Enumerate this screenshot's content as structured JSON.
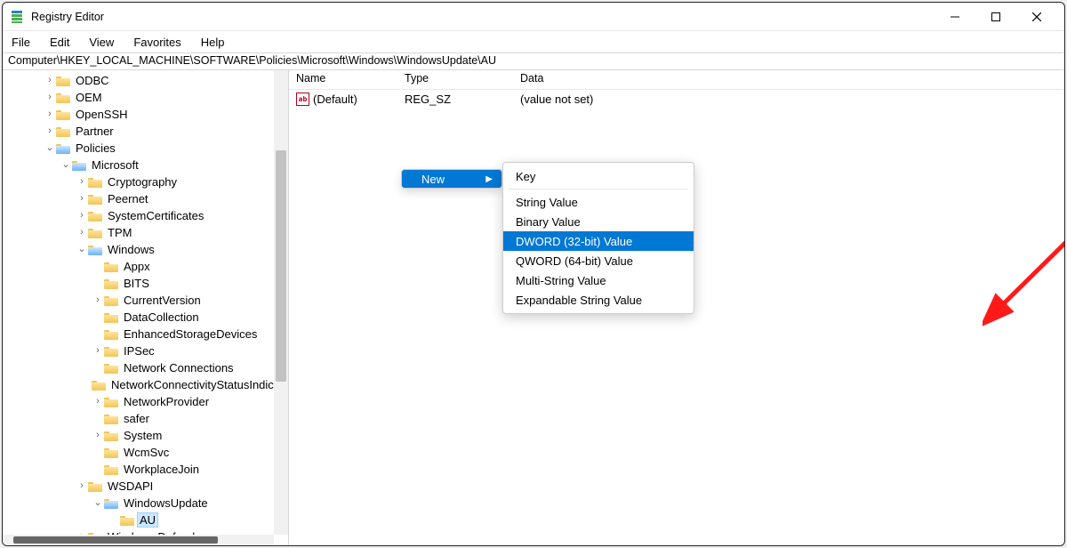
{
  "title": "Registry Editor",
  "menubar": [
    "File",
    "Edit",
    "View",
    "Favorites",
    "Help"
  ],
  "address": "Computer\\HKEY_LOCAL_MACHINE\\SOFTWARE\\Policies\\Microsoft\\Windows\\WindowsUpdate\\AU",
  "columns": {
    "name": "Name",
    "type": "Type",
    "data": "Data"
  },
  "default_value": {
    "name": "(Default)",
    "type": "REG_SZ",
    "data": "(value not set)"
  },
  "tree": [
    {
      "indent": 46,
      "expander": ">",
      "label": "ODBC"
    },
    {
      "indent": 46,
      "expander": ">",
      "label": "OEM"
    },
    {
      "indent": 46,
      "expander": ">",
      "label": "OpenSSH"
    },
    {
      "indent": 46,
      "expander": ">",
      "label": "Partner"
    },
    {
      "indent": 46,
      "expander": "v",
      "label": "Policies",
      "open": true
    },
    {
      "indent": 64,
      "expander": "v",
      "label": "Microsoft",
      "open": true
    },
    {
      "indent": 82,
      "expander": ">",
      "label": "Cryptography"
    },
    {
      "indent": 82,
      "expander": ">",
      "label": "Peernet"
    },
    {
      "indent": 82,
      "expander": ">",
      "label": "SystemCertificates"
    },
    {
      "indent": 82,
      "expander": ">",
      "label": "TPM"
    },
    {
      "indent": 82,
      "expander": "v",
      "label": "Windows",
      "open": true
    },
    {
      "indent": 100,
      "expander": "",
      "label": "Appx"
    },
    {
      "indent": 100,
      "expander": "",
      "label": "BITS"
    },
    {
      "indent": 100,
      "expander": ">",
      "label": "CurrentVersion"
    },
    {
      "indent": 100,
      "expander": "",
      "label": "DataCollection"
    },
    {
      "indent": 100,
      "expander": "",
      "label": "EnhancedStorageDevices"
    },
    {
      "indent": 100,
      "expander": ">",
      "label": "IPSec"
    },
    {
      "indent": 100,
      "expander": "",
      "label": "Network Connections"
    },
    {
      "indent": 100,
      "expander": "",
      "label": "NetworkConnectivityStatusIndicator"
    },
    {
      "indent": 100,
      "expander": ">",
      "label": "NetworkProvider"
    },
    {
      "indent": 100,
      "expander": "",
      "label": "safer"
    },
    {
      "indent": 100,
      "expander": ">",
      "label": "System"
    },
    {
      "indent": 100,
      "expander": "",
      "label": "WcmSvc"
    },
    {
      "indent": 100,
      "expander": "",
      "label": "WorkplaceJoin"
    },
    {
      "indent": 82,
      "expander": ">",
      "label": "WSDAPI"
    },
    {
      "indent": 100,
      "expander": "v",
      "label": "WindowsUpdate",
      "open": true
    },
    {
      "indent": 118,
      "expander": "",
      "label": "AU",
      "selected": true
    },
    {
      "indent": 82,
      "expander": ">",
      "label": "Windows Defender"
    }
  ],
  "context_new_label": "New",
  "submenu": {
    "items": [
      {
        "label": "Key",
        "sep_after": true
      },
      {
        "label": "String Value"
      },
      {
        "label": "Binary Value"
      },
      {
        "label": "DWORD (32-bit) Value",
        "highlight": true
      },
      {
        "label": "QWORD (64-bit) Value"
      },
      {
        "label": "Multi-String Value"
      },
      {
        "label": "Expandable String Value"
      }
    ]
  }
}
